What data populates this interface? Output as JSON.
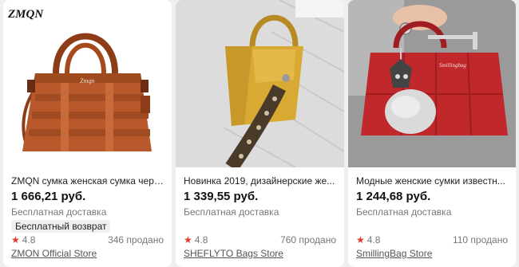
{
  "products": [
    {
      "title": "ZMQN сумка женская сумка чере...",
      "price": "1 666,21 руб.",
      "shipping": "Бесплатная доставка",
      "badge": "Бесплатный возврат",
      "rating": "4.8",
      "sold": "346 продано",
      "store": "ZMON Official Store",
      "brand_mark": "ZMQN",
      "bag_brand": "Zmqn",
      "colors": {
        "bag": "#b9582a",
        "bg": "#ffffff"
      }
    },
    {
      "title": "Новинка 2019, дизайнерские же...",
      "price": "1 339,55 руб.",
      "shipping": "Бесплатная доставка",
      "rating": "4.8",
      "sold": "760 продано",
      "store": "SHEFLYTO Bags Store",
      "colors": {
        "bag": "#d8a933",
        "bg": "#e9e9e9"
      }
    },
    {
      "title": "Модные женские сумки известн...",
      "price": "1 244,68 руб.",
      "shipping": "Бесплатная доставка",
      "rating": "4.8",
      "sold": "110 продано",
      "store": "SmillingBag Store",
      "bag_brand": "Smillingbag",
      "colors": {
        "bag": "#c1282b",
        "bg": "#9a9a9a"
      }
    }
  ],
  "icons": {
    "rating": "star-icon"
  }
}
